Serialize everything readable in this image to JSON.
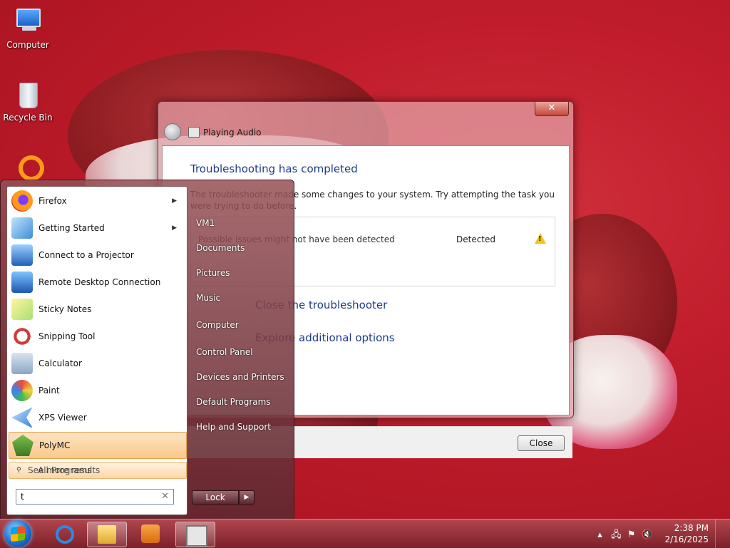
{
  "desktop": {
    "icons": [
      {
        "label": "Computer",
        "icon": "computer-icon"
      },
      {
        "label": "Recycle Bin",
        "icon": "recycle-bin-icon"
      }
    ]
  },
  "dialog": {
    "window_title": "Playing Audio",
    "close_glyph": "✕",
    "heading": "Troubleshooting has completed",
    "description": "The troubleshooter made some changes to your system. Try attempting the task you were trying to do before.",
    "issue_name": "Possible issues might not have been detected",
    "issue_status": "Detected",
    "link_close": "Close the troubleshooter",
    "link_explore": "Explore additional options",
    "close_button": "Close"
  },
  "start_menu": {
    "programs": [
      {
        "label": "Firefox",
        "icon": "firefox-icon",
        "has_submenu": true
      },
      {
        "label": "Getting Started",
        "icon": "getting-started-icon",
        "has_submenu": true
      },
      {
        "label": "Connect to a Projector",
        "icon": "projector-icon",
        "has_submenu": false
      },
      {
        "label": "Remote Desktop Connection",
        "icon": "remote-desktop-icon",
        "has_submenu": false
      },
      {
        "label": "Sticky Notes",
        "icon": "sticky-notes-icon",
        "has_submenu": false
      },
      {
        "label": "Snipping Tool",
        "icon": "snipping-tool-icon",
        "has_submenu": false
      },
      {
        "label": "Calculator",
        "icon": "calculator-icon",
        "has_submenu": false
      },
      {
        "label": "Paint",
        "icon": "paint-icon",
        "has_submenu": false
      },
      {
        "label": "XPS Viewer",
        "icon": "xps-viewer-icon",
        "has_submenu": false
      },
      {
        "label": "PolyMC",
        "icon": "polymc-icon",
        "has_submenu": false,
        "highlighted": true
      }
    ],
    "all_programs_overlay": "See more results",
    "all_programs": "All Programs",
    "search_value": "t",
    "search_clear": "✕",
    "right_items": [
      "VM1",
      "Documents",
      "Pictures",
      "Music",
      "Computer",
      "Control Panel",
      "Devices and Printers",
      "Default Programs",
      "Help and Support"
    ],
    "lock_label": "Lock",
    "lock_arrow": "▶"
  },
  "taskbar": {
    "pinned": [
      {
        "icon": "internet-explorer-icon"
      },
      {
        "icon": "windows-explorer-icon"
      },
      {
        "icon": "media-player-icon"
      },
      {
        "icon": "playing-audio-icon"
      }
    ],
    "tray_icons": [
      "▴",
      "🖧",
      "⚑",
      "🔇"
    ],
    "time": "2:38 PM",
    "date": "2/16/2025"
  },
  "colors": {
    "accent": "#c11d2c",
    "link": "#1e3a8a",
    "warning": "#f3c21b"
  }
}
